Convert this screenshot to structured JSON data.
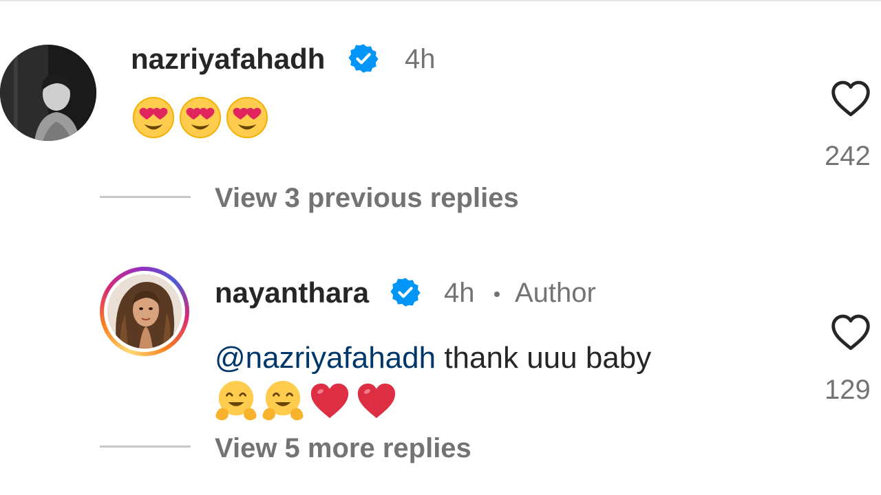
{
  "comments": [
    {
      "username": "nazriyafahadh",
      "verified": true,
      "time": "4h",
      "emojis": [
        "heart-eyes-emoji",
        "heart-eyes-emoji",
        "heart-eyes-emoji"
      ],
      "likes": "242",
      "view_replies": "View 3 previous replies"
    },
    {
      "username": "nayanthara",
      "verified": true,
      "time": "4h",
      "author_label": "Author",
      "mention": "@nazriyafahadh",
      "text": "thank uuu baby",
      "emojis": [
        "hugging-face-emoji",
        "hugging-face-emoji",
        "red-heart-emoji",
        "red-heart-emoji"
      ],
      "likes": "129",
      "view_replies": "View 5 more replies"
    }
  ],
  "colors": {
    "verified_blue": "#0095f6",
    "mention_blue": "#00376b",
    "secondary_text": "#737373",
    "primary_text": "#262626"
  }
}
